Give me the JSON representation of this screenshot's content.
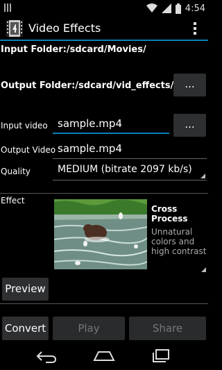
{
  "status_bar": {
    "time": "4:54"
  },
  "action_bar": {
    "title": "Video Effects"
  },
  "input_folder": {
    "label": "Input Folder:",
    "path": "/sdcard/Movies/"
  },
  "output_folder": {
    "label": "Output Folder:",
    "path": "/sdcard/vid_effects/",
    "browse_label": "..."
  },
  "input_video": {
    "label": "Input video",
    "value": "sample.mp4",
    "browse_label": "..."
  },
  "output_video": {
    "label": "Output Video",
    "value": "sample.mp4"
  },
  "quality": {
    "label": "Quality",
    "value": "MEDIUM (bitrate 2097 kb/s)"
  },
  "effect": {
    "label": "Effect",
    "name": "Cross Process",
    "description": "Unnatural colors and high contrast"
  },
  "buttons": {
    "preview": "Preview",
    "convert": "Convert",
    "play": "Play",
    "share": "Share"
  },
  "colors": {
    "accent": "#0c81b5",
    "button_bg": "#2e2f31",
    "disabled_text": "#777777"
  }
}
